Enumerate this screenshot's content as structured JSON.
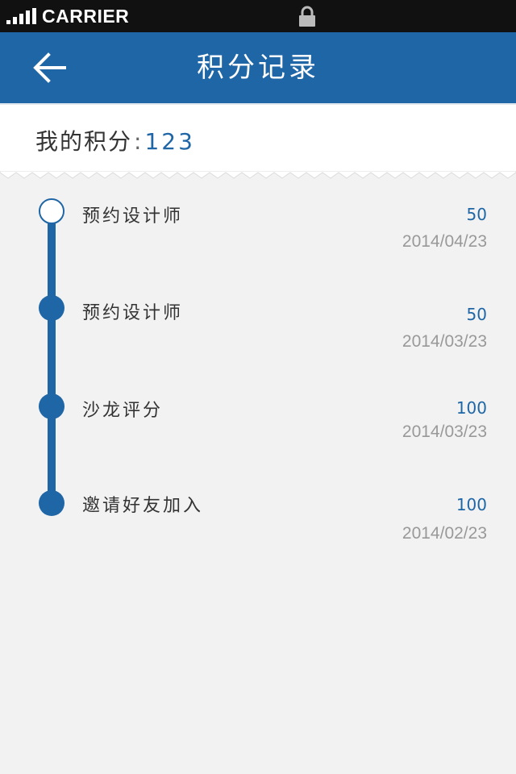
{
  "status_bar": {
    "carrier": "CARRIER",
    "signal_icon": "signal-bars-icon",
    "lock_icon": "lock-icon"
  },
  "nav": {
    "title": "积分记录",
    "back_icon": "arrow-left-icon"
  },
  "points": {
    "label": "我的积分",
    "separator": ":",
    "value": "123"
  },
  "records": [
    {
      "title": "预约设计师",
      "points": "50",
      "date": "2014/04/23",
      "marker": "hollow"
    },
    {
      "title": "预约设计师",
      "points": "50",
      "date": "2014/03/23",
      "marker": "filled"
    },
    {
      "title": "沙龙评分",
      "points": "100",
      "date": "2014/03/23",
      "marker": "filled"
    },
    {
      "title": "邀请好友加入",
      "points": "100",
      "date": "2014/02/23",
      "marker": "filled"
    }
  ],
  "colors": {
    "accent": "#1f66a6",
    "background": "#f2f2f2",
    "status_bar": "#111111",
    "date_text": "#999999"
  }
}
